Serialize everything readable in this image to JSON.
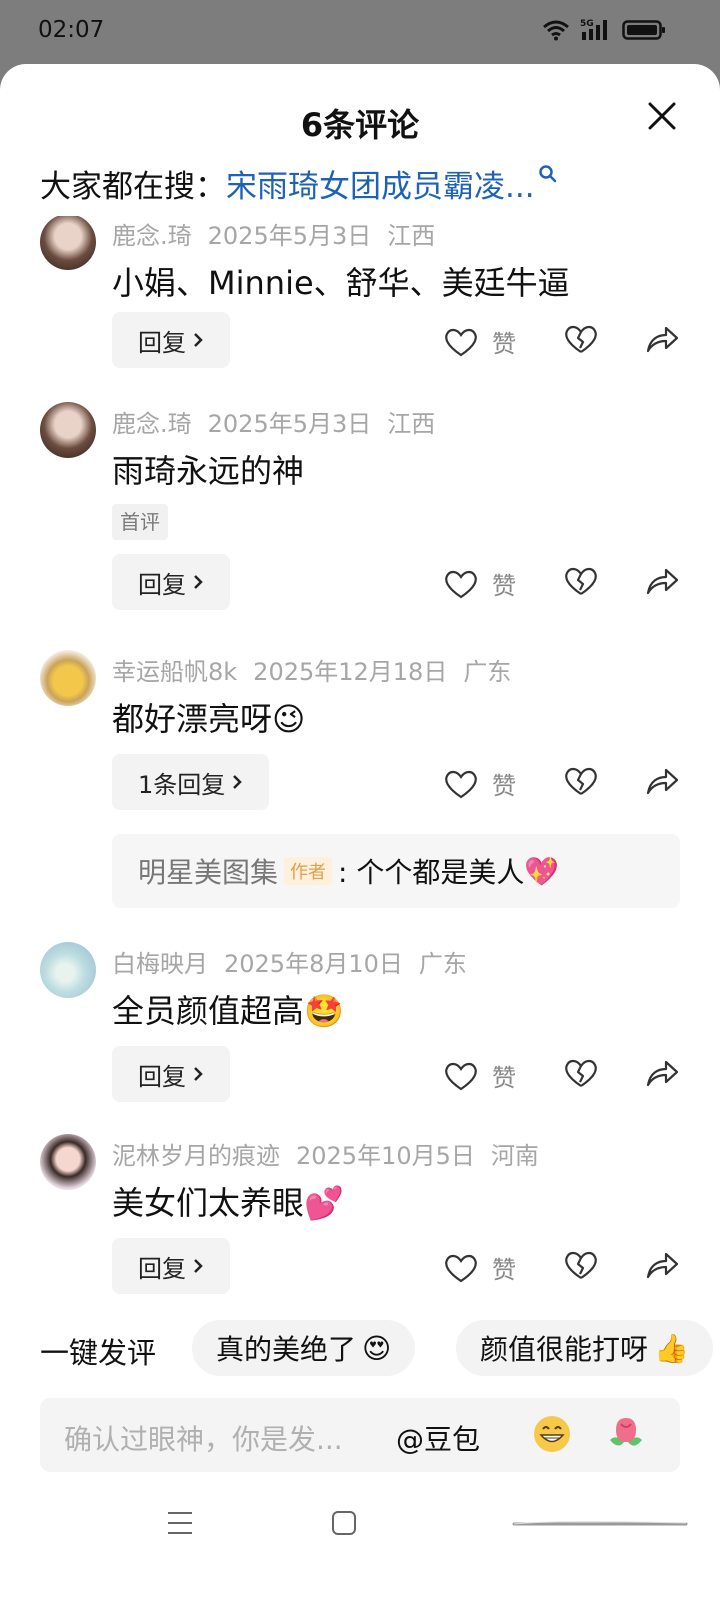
{
  "status": {
    "time": "02:07",
    "network": "5G"
  },
  "header": {
    "title": "6条评论"
  },
  "search": {
    "prefix": "大家都在搜：",
    "query": "宋雨琦女团成员霸凌..."
  },
  "comments": [
    {
      "user": "鹿念.琦",
      "date": "2025年5月3日",
      "region": "江西",
      "text": "小娟、Minnie、舒华、美廷牛逼",
      "reply_label": "回复",
      "like_label": "赞"
    },
    {
      "user": "鹿念.琦",
      "date": "2025年5月3日",
      "region": "江西",
      "text": "雨琦永远的神",
      "tag": "首评",
      "reply_label": "回复",
      "like_label": "赞"
    },
    {
      "user": "幸运船帆8k",
      "date": "2025年12月18日",
      "region": "广东",
      "text": "都好漂亮呀",
      "reply_label": "1条回复",
      "like_label": "赞",
      "sub_reply": {
        "user": "明星美图集",
        "author_tag": "作者",
        "text": ": 个个都是美人"
      }
    },
    {
      "user": "白梅映月",
      "date": "2025年8月10日",
      "region": "广东",
      "text": "全员颜值超高",
      "reply_label": "回复",
      "like_label": "赞"
    },
    {
      "user": "泥林岁月的痕迹",
      "date": "2025年10月5日",
      "region": "河南",
      "text": "美女们太养眼",
      "reply_label": "回复",
      "like_label": "赞"
    }
  ],
  "quick_comment": {
    "label": "一键发评",
    "chips": [
      "真的美绝了",
      "颜值很能打呀"
    ]
  },
  "input": {
    "placeholder": "确认过眼神，你是发...",
    "mention": "@豆包"
  },
  "colors": {
    "link": "#1e62b8",
    "author_tag_bg": "#fdf0dc",
    "author_tag_text": "#e0a050"
  }
}
